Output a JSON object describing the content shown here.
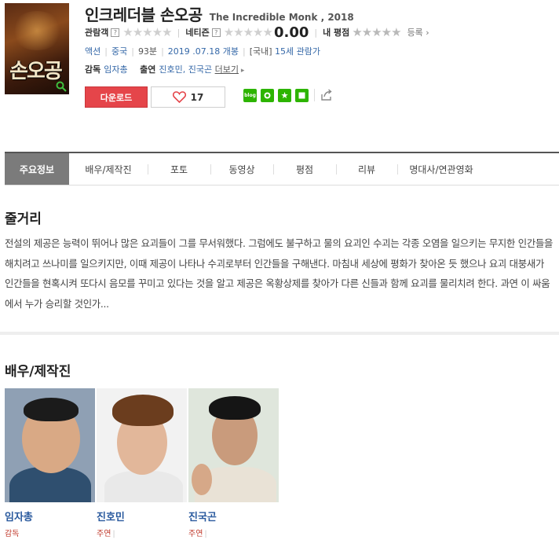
{
  "movie": {
    "title_kr": "인크레더블 손오공",
    "title_en": "The Incredible Monk , 2018",
    "poster_title": "손오공",
    "ratings": {
      "audience_label": "관람객",
      "netizen_label": "네티즌",
      "netizen_score": "0.00",
      "my_rating_label": "내 평점",
      "register_label": "등록"
    },
    "genre": "액션",
    "country": "중국",
    "runtime": "93분",
    "release": "2019 .07.18 개봉",
    "grade_prefix": "[국내]",
    "grade": "15세 관람가",
    "director_label": "감독",
    "director": "임자총",
    "cast_label": "출연",
    "cast_names": "진호민, 진국곤",
    "more_label": "더보기",
    "download_label": "다운로드",
    "like_count": "17",
    "share_icons": [
      "blog-icon",
      "cafe-icon",
      "star-icon",
      "band-icon",
      "share-icon"
    ]
  },
  "tabs": [
    {
      "label": "주요정보",
      "active": true
    },
    {
      "label": "배우/제작진",
      "active": false
    },
    {
      "label": "포토",
      "active": false
    },
    {
      "label": "동영상",
      "active": false
    },
    {
      "label": "평점",
      "active": false
    },
    {
      "label": "리뷰",
      "active": false
    },
    {
      "label": "명대사/연관영화",
      "active": false
    }
  ],
  "synopsis": {
    "heading": "줄거리",
    "text": "전설의 제공은 능력이 뛰어나 많은 요괴들이 그를 무서워했다. 그럼에도 불구하고 물의 요괴인 수괴는 각종 오염을 일으키는 무지한 인간들을 해치려고 쓰나미를 일으키지만, 이때 제공이 나타나 수괴로부터 인간들을 구해낸다. 마침내 세상에 평화가 찾아온 듯 했으나 요괴 대붕새가 인간들을 현혹시켜 또다시 음모를 꾸미고 있다는 것을 알고 제공은 옥황상제를 찾아가 다른 신들과 함께 요괴를 물리치려 한다. 과연 이 싸움에서 누가 승리할 것인가..."
  },
  "cast_section": {
    "heading": "배우/제작진",
    "people": [
      {
        "name": "임자총",
        "role": "감독"
      },
      {
        "name": "진호민",
        "role": "주연"
      },
      {
        "name": "진국곤",
        "role": "주연"
      }
    ]
  },
  "colors": {
    "accent_red": "#e5454a",
    "link_blue": "#3568a8",
    "active_tab": "#7b7b7b"
  }
}
